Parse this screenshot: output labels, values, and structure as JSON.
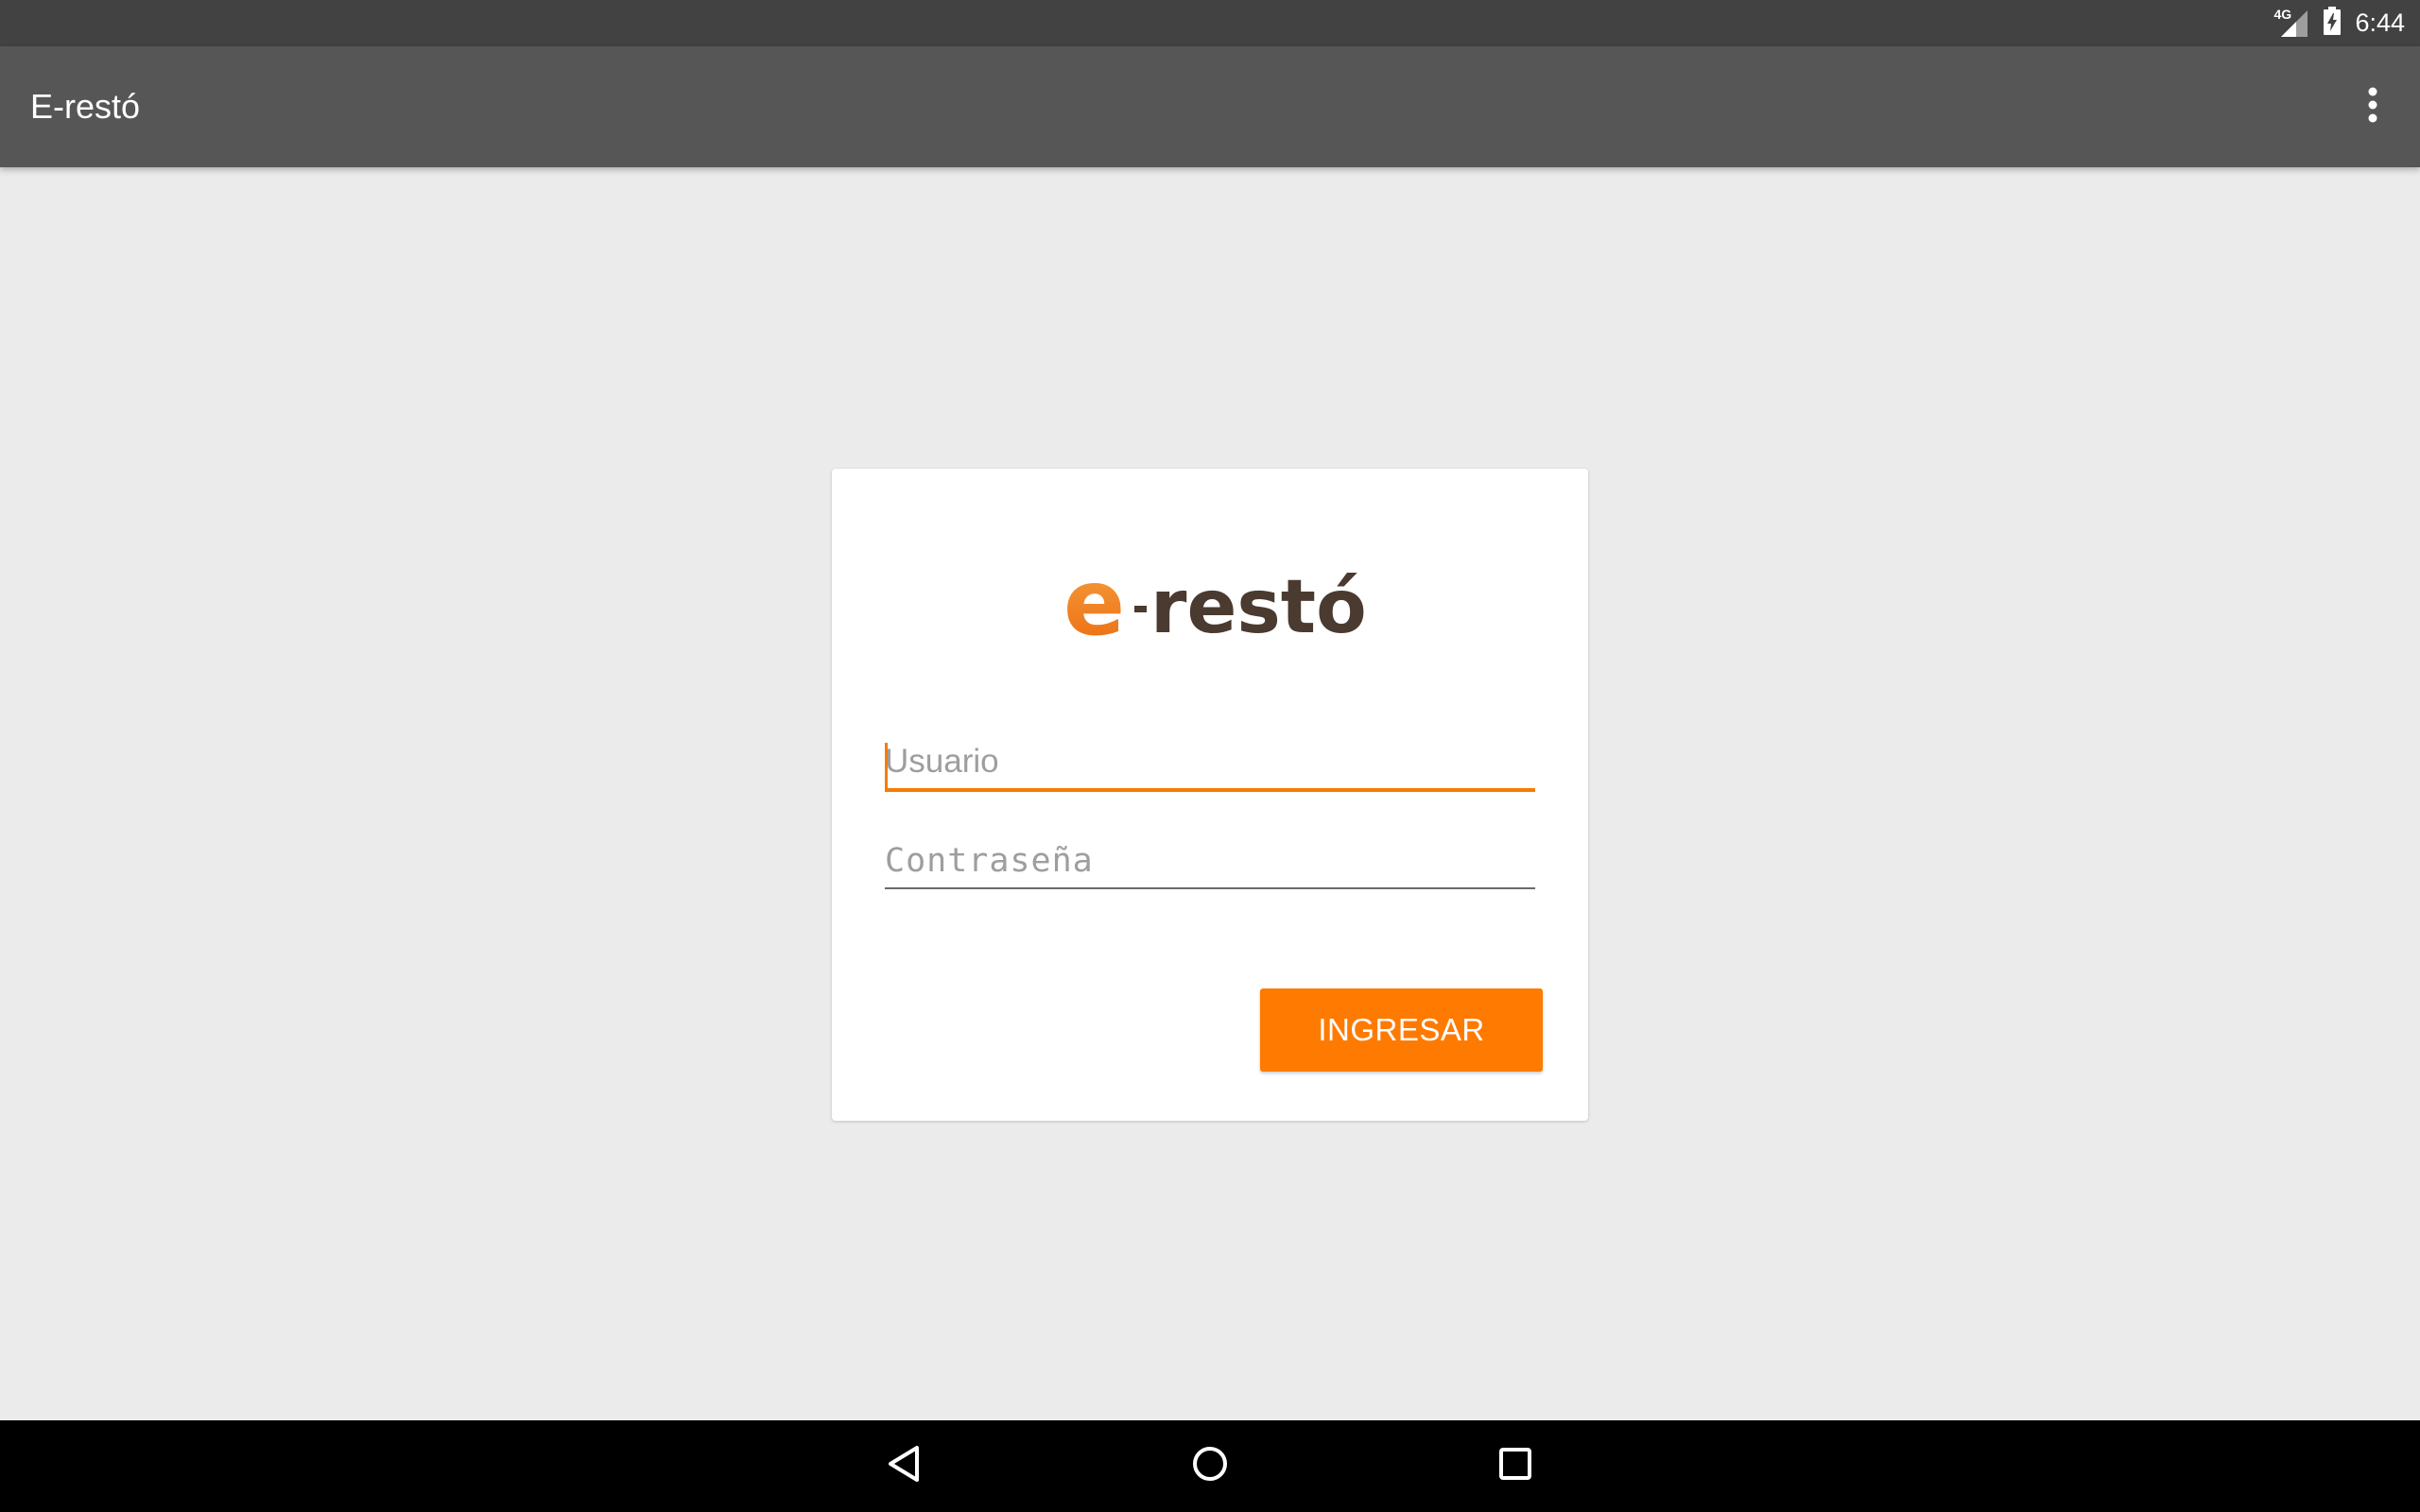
{
  "status_bar": {
    "network_label": "4G",
    "time": "6:44"
  },
  "app_bar": {
    "title": "E-restó",
    "menu_icon": "more-vert-icon"
  },
  "login_card": {
    "logo_text": "e-restó",
    "username_placeholder": "Usuario",
    "password_placeholder": "Contraseña",
    "submit_label": "INGRESAR"
  },
  "nav_bar": {
    "back_icon": "back-icon",
    "home_icon": "home-icon",
    "recents_icon": "recents-icon"
  },
  "colors": {
    "accent": "#ff7a00",
    "app_bar": "#565656",
    "status_bar": "#424242",
    "background": "#ebebeb",
    "logo_dark": "#4a3a30"
  }
}
